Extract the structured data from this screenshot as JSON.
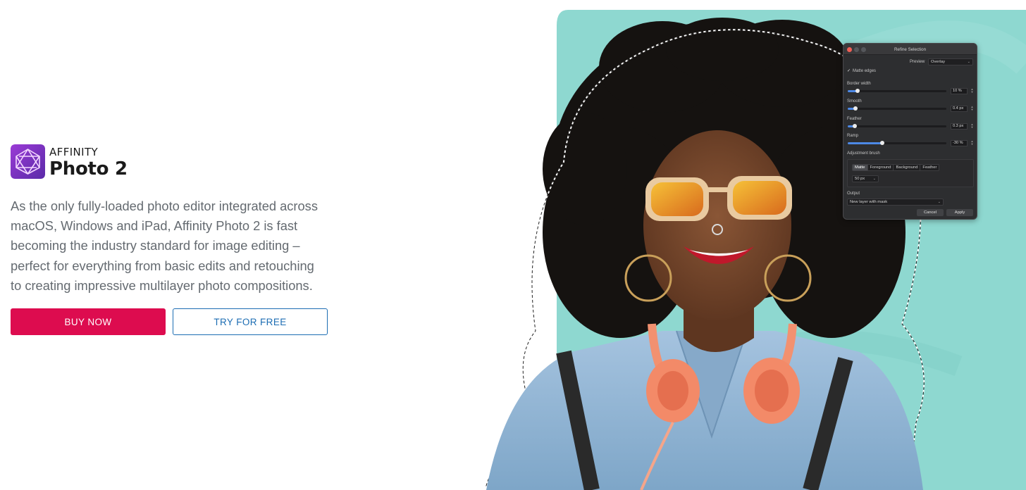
{
  "logo": {
    "brand": "AFFINITY",
    "product": "Photo 2",
    "icon": "affinity-photo-logo-icon",
    "colors": {
      "gradient_start": "#9b3bd6",
      "gradient_end": "#5a2aa8"
    }
  },
  "hero": {
    "description_lines": [
      "As the only fully-loaded photo editor integrated across",
      "macOS, Windows and iPad, Affinity Photo 2 is fast",
      "becoming the industry standard for image editing –",
      "perfect for everything from basic edits and retouching",
      "to creating impressive multilayer photo compositions."
    ],
    "buy_label": "BUY NOW",
    "try_label": "TRY FOR FREE",
    "colors": {
      "buy_bg": "#dd0c4f",
      "try_border": "#1c6db3",
      "text": "#646a70",
      "backdrop": "#8ed8d0"
    }
  },
  "dialog": {
    "title": "Refine Selection",
    "preview_label": "Preview",
    "preview_value": "Overlay",
    "matte_edges_check": "✓",
    "matte_edges_label": "Matte edges",
    "matte_edges_checked": true,
    "sliders": [
      {
        "label": "Border width",
        "value": "10 %",
        "fraction": 0.1
      },
      {
        "label": "Smooth",
        "value": "0.4 px",
        "fraction": 0.08
      },
      {
        "label": "Feather",
        "value": "0.3 px",
        "fraction": 0.07
      },
      {
        "label": "Ramp",
        "value": "-30 %",
        "fraction": 0.35
      }
    ],
    "adjustment_brush_label": "Adjustment brush",
    "brush_modes": [
      "Matte",
      "Foreground",
      "Background",
      "Feather"
    ],
    "brush_mode_selected": "Matte",
    "brush_size": "50 px",
    "output_label": "Output",
    "output_value": "New layer with mask",
    "cancel_label": "Cancel",
    "apply_label": "Apply",
    "caret": "⌄",
    "stepper_up": "▲",
    "stepper_down": "▼"
  }
}
